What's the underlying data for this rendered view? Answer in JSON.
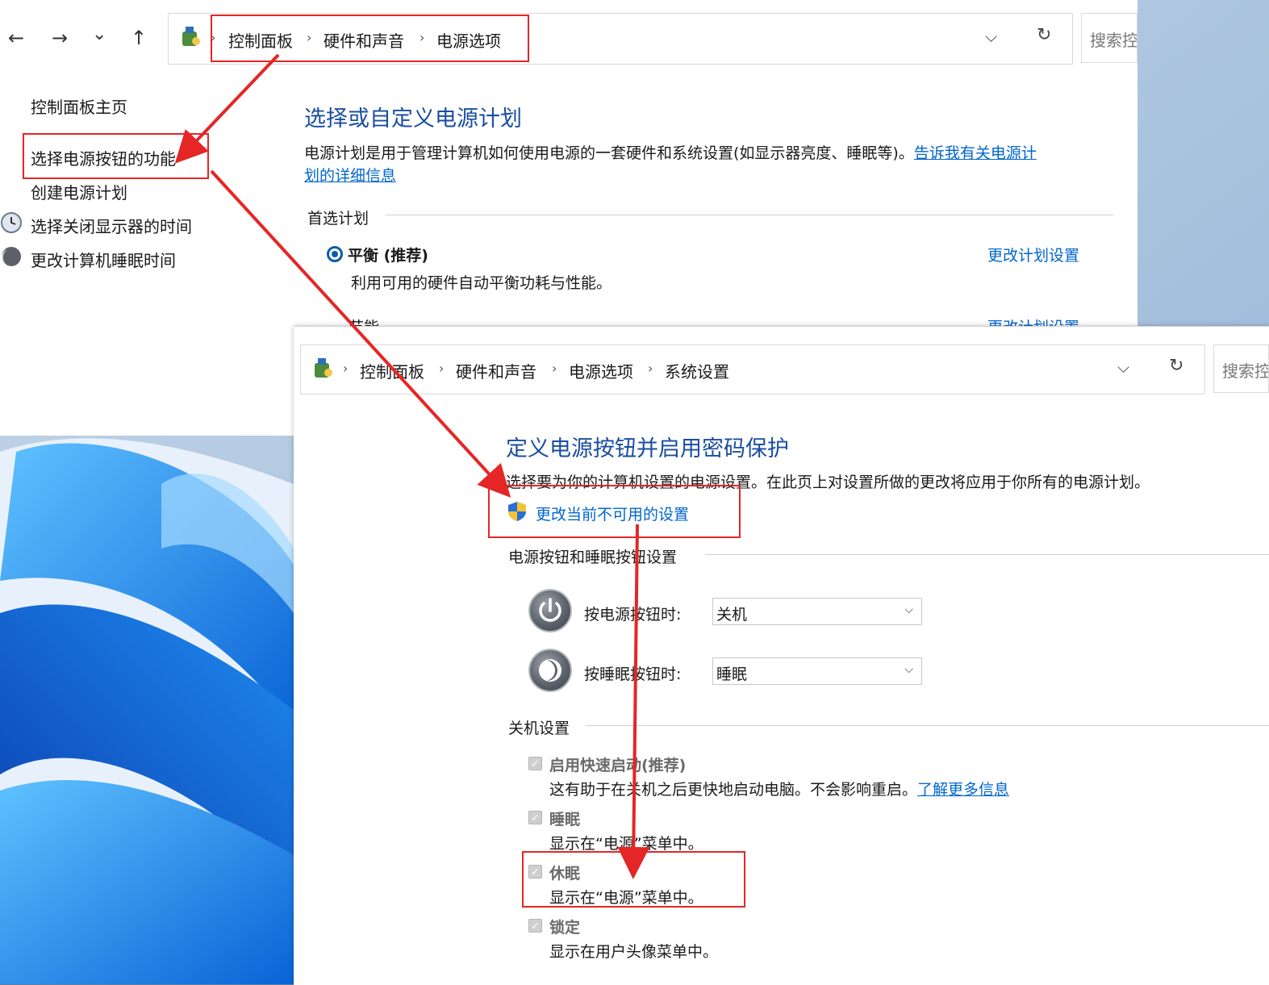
{
  "window_back": {
    "nav": {
      "back_icon": "←",
      "forward_icon": "→",
      "recent_icon": "⌄",
      "up_icon": "↑"
    },
    "breadcrumb": [
      "控制面板",
      "硬件和声音",
      "电源选项"
    ],
    "search_placeholder": "搜索控",
    "sidebar": {
      "home": "控制面板主页",
      "items": [
        "选择电源按钮的功能",
        "创建电源计划",
        "选择关闭显示器的时间",
        "更改计算机睡眠时间"
      ]
    },
    "main": {
      "title": "选择或自定义电源计划",
      "desc": "电源计划是用于管理计算机如何使用电源的一套硬件和系统设置(如显示器亮度、睡眠等)。",
      "desc_link_1": "告诉我有关电源计",
      "desc_link_2": "划的详细信息",
      "section": "首选计划",
      "plan_name": "平衡 (推荐)",
      "plan_desc": "利用可用的硬件自动平衡功耗与性能。",
      "plan_link": "更改计划设置",
      "plan2_name": "节能",
      "plan2_link": "更改计划设置"
    }
  },
  "window_front": {
    "breadcrumb": [
      "控制面板",
      "硬件和声音",
      "电源选项",
      "系统设置"
    ],
    "search_placeholder": "搜索控",
    "title": "定义电源按钮并启用密码保护",
    "desc": "选择要为你的计算机设置的电源设置。在此页上对设置所做的更改将应用于你所有的电源计划。",
    "change_link": "更改当前不可用的设置",
    "section_buttons": "电源按钮和睡眠按钮设置",
    "power_button_label": "按电源按钮时:",
    "power_button_value": "关机",
    "sleep_button_label": "按睡眠按钮时:",
    "sleep_button_value": "睡眠",
    "section_shutdown": "关机设置",
    "options": [
      {
        "label": "启用快速启动(推荐)",
        "desc": "这有助于在关机之后更快地启动电脑。不会影响重启。",
        "link": "了解更多信息"
      },
      {
        "label": "睡眠",
        "desc": "显示在“电源”菜单中。"
      },
      {
        "label": "休眠",
        "desc": "显示在“电源”菜单中。"
      },
      {
        "label": "锁定",
        "desc": "显示在用户头像菜单中。"
      }
    ]
  },
  "colors": {
    "accent": "#1a4ea1",
    "link": "#0066cc",
    "annotation": "#e52626"
  }
}
